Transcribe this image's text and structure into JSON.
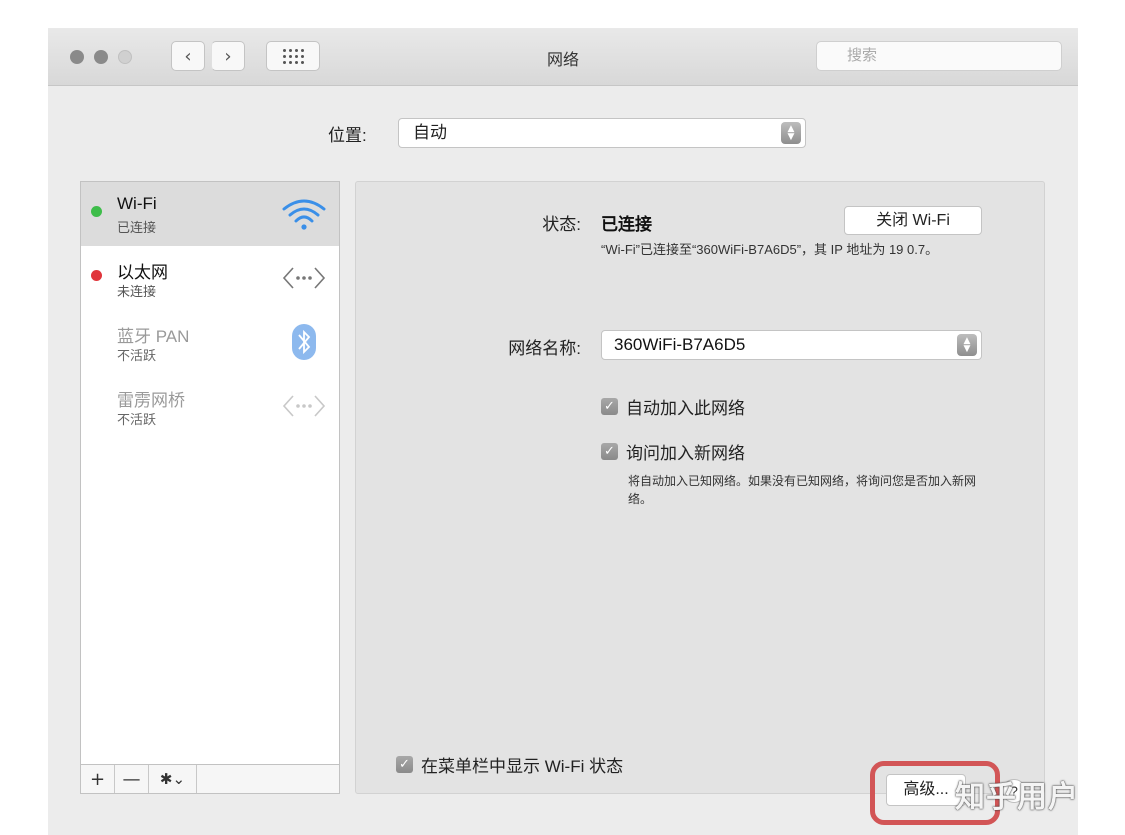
{
  "window": {
    "title": "网络"
  },
  "toolbar": {
    "back_label": "‹",
    "forward_label": "›"
  },
  "search": {
    "placeholder": "搜索"
  },
  "location": {
    "label": "位置:",
    "value": "自动"
  },
  "services": [
    {
      "name": "Wi-Fi",
      "status": "已连接",
      "indicator": "green",
      "icon": "wifi-icon",
      "active": true
    },
    {
      "name": "以太网",
      "status": "未连接",
      "indicator": "red",
      "icon": "ethernet-icon",
      "active": false
    },
    {
      "name": "蓝牙 PAN",
      "status": "不活跃",
      "indicator": "none",
      "icon": "bluetooth-icon",
      "active": false
    },
    {
      "name": "雷雳网桥",
      "status": "不活跃",
      "indicator": "none",
      "icon": "thunderbolt-bridge-icon",
      "active": false
    }
  ],
  "sidebar_footer": {
    "add": "+",
    "remove": "—",
    "gear": "✱⌄"
  },
  "detail": {
    "status_label": "状态:",
    "status_value": "已连接",
    "wifi_off_button": "关闭 Wi-Fi",
    "status_desc": "“Wi-Fi”已连接至“360WiFi-B7A6D5”，其 IP 地址为 19        0.7。",
    "network_name_label": "网络名称:",
    "network_name_value": "360WiFi-B7A6D5",
    "auto_join_label": "自动加入此网络",
    "ask_join_label": "询问加入新网络",
    "ask_join_note": "将自动加入已知网络。如果没有已知网络，将询问您是否加入新网络。",
    "show_menubar_label": "在菜单栏中显示 Wi-Fi 状态",
    "advanced_button": "高级...",
    "help_button": "?"
  },
  "watermark": "知乎用户",
  "colors": {
    "connected": "#3ebd4a",
    "disconnected": "#e0353b",
    "highlight": "#d25556",
    "bluetooth": "#6aa7ec"
  }
}
